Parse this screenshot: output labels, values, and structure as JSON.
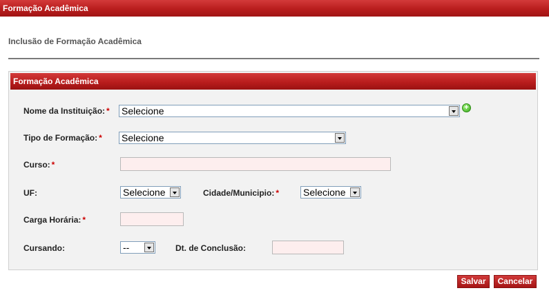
{
  "header": {
    "title": "Formação Acadêmica"
  },
  "page": {
    "subtitle": "Inclusão de Formação Acadêmica"
  },
  "panel": {
    "title": "Formação Acadêmica",
    "fields": {
      "instituicao": {
        "label": "Nome da Instituição:",
        "required_mark": "*",
        "value": "Selecione"
      },
      "tipo_formacao": {
        "label": "Tipo de Formação:",
        "required_mark": "*",
        "value": "Selecione"
      },
      "curso": {
        "label": "Curso:",
        "required_mark": "*",
        "value": ""
      },
      "uf": {
        "label": "UF:",
        "value": "Selecione"
      },
      "cidade": {
        "label": "Cidade/Municipio:",
        "required_mark": "*",
        "value": "Selecione"
      },
      "carga_horaria": {
        "label": "Carga Horária:",
        "required_mark": "*",
        "value": ""
      },
      "cursando": {
        "label": "Cursando:",
        "value": "--"
      },
      "dt_conclusao": {
        "label": "Dt. de Conclusão:",
        "value": ""
      }
    }
  },
  "actions": {
    "save_label": "Salvar",
    "cancel_label": "Cancelar"
  },
  "icons": {
    "add": "plus-circle-icon",
    "dropdown": "chevron-down-icon"
  },
  "colors": {
    "header_red": "#b91d1d",
    "required": "#cc0000",
    "input_bg": "#fdeeee",
    "add_green": "#3aa81c"
  }
}
